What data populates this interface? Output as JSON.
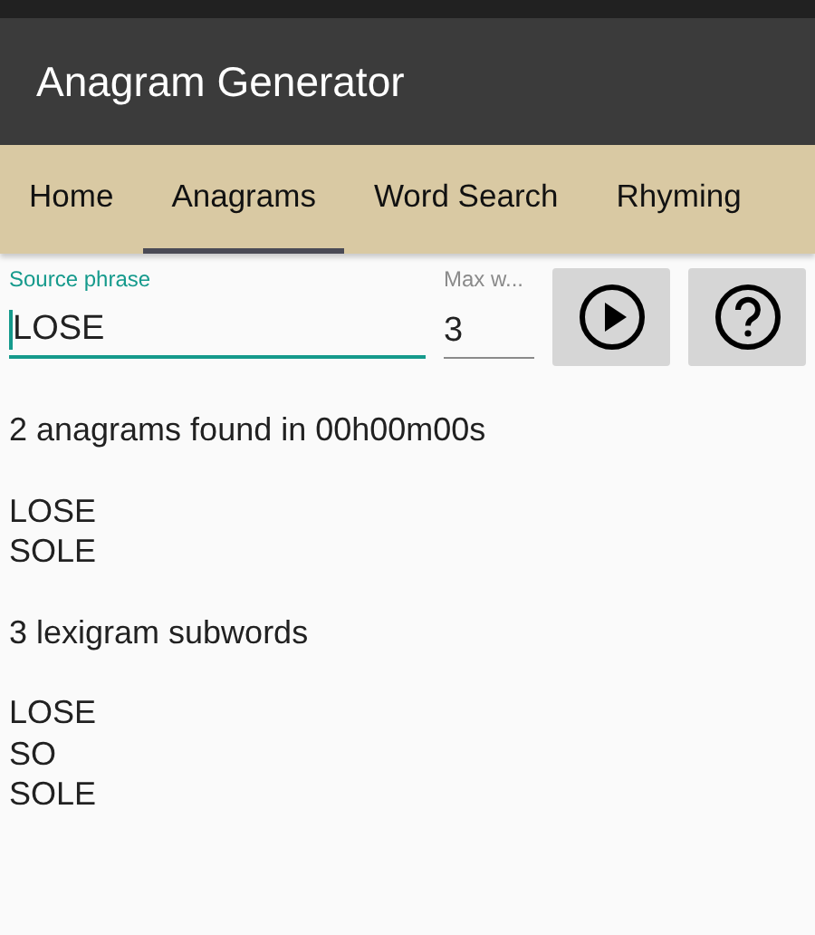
{
  "app_bar": {
    "title": "Anagram Generator"
  },
  "tabs": [
    {
      "label": "Home",
      "selected": false
    },
    {
      "label": "Anagrams",
      "selected": true
    },
    {
      "label": "Word Search",
      "selected": false
    },
    {
      "label": "Rhyming",
      "selected": false
    }
  ],
  "source_field": {
    "label": "Source phrase",
    "value": "LOSE",
    "focused": true
  },
  "max_words_field": {
    "label": "Max w...",
    "value": "3",
    "focused": false
  },
  "results": [
    {
      "heading": "2 anagrams found in 00h00m00s",
      "words": [
        "LOSE",
        "SOLE"
      ]
    },
    {
      "heading": "3 lexigram subwords",
      "words": [
        "LOSE",
        "SO",
        "SOLE"
      ]
    }
  ]
}
